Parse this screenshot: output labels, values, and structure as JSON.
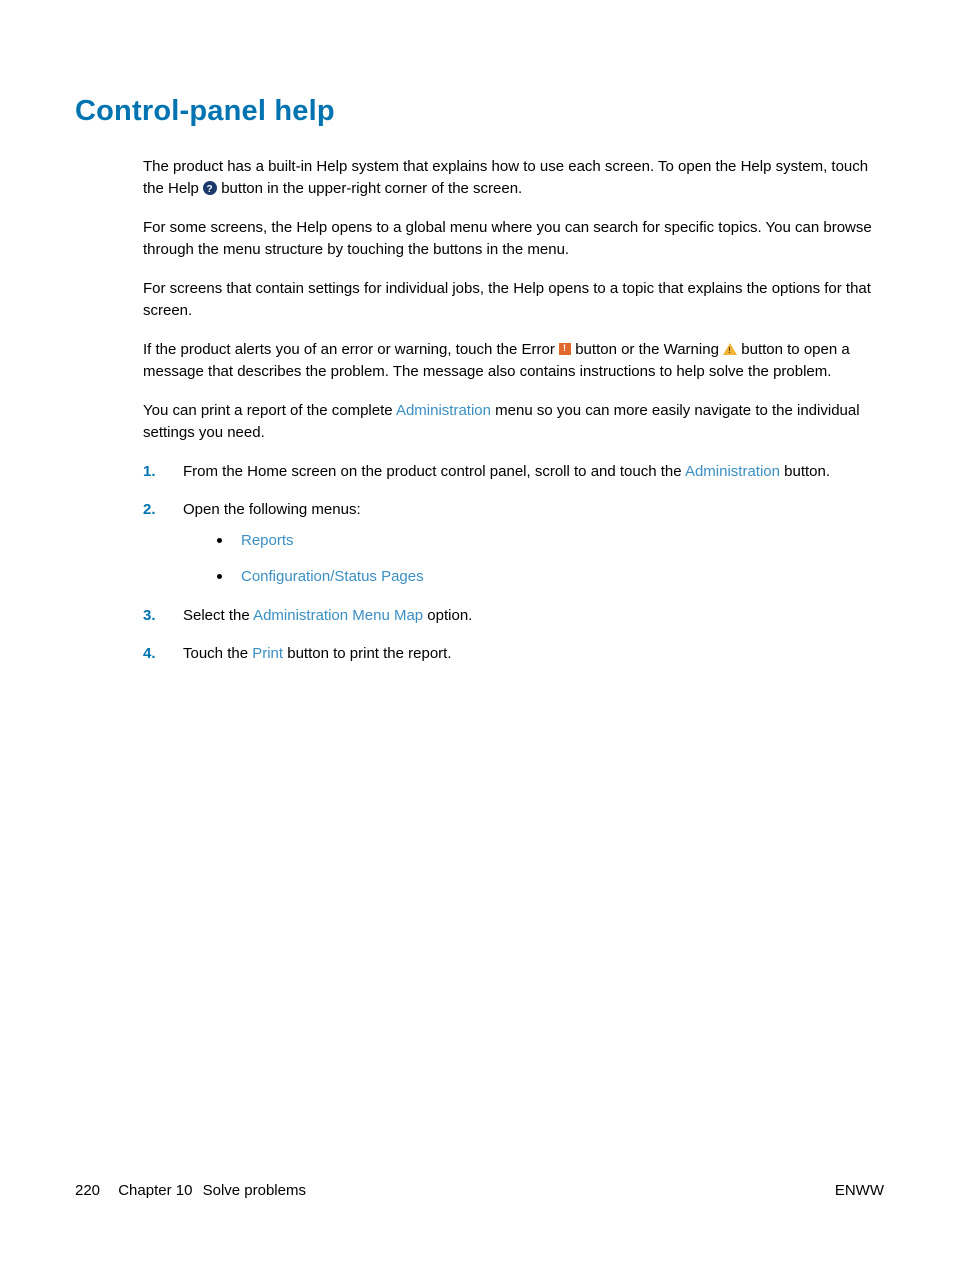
{
  "title": "Control-panel help",
  "para1_a": "The product has a built-in Help system that explains how to use each screen. To open the Help system, touch the Help ",
  "para1_b": " button in the upper-right corner of the screen.",
  "para2": "For some screens, the Help opens to a global menu where you can search for specific topics. You can browse through the menu structure by touching the buttons in the menu.",
  "para3": "For screens that contain settings for individual jobs, the Help opens to a topic that explains the options for that screen.",
  "para4_a": "If the product alerts you of an error or warning, touch the Error ",
  "para4_b": " button or the Warning ",
  "para4_c": " button to open a message that describes the problem. The message also contains instructions to help solve the problem.",
  "para5_a": "You can print a report of the complete ",
  "para5_admin": "Administration",
  "para5_b": " menu so you can more easily navigate to the individual settings you need.",
  "steps": {
    "s1_num": "1.",
    "s1_a": "From the Home screen on the product control panel, scroll to and touch the ",
    "s1_link": "Administration",
    "s1_b": " button.",
    "s2_num": "2.",
    "s2_text": "Open the following menus:",
    "s2_sub1": "Reports",
    "s2_sub2": "Configuration/Status Pages",
    "s3_num": "3.",
    "s3_a": "Select the ",
    "s3_link": "Administration Menu Map",
    "s3_b": " option.",
    "s4_num": "4.",
    "s4_a": "Touch the ",
    "s4_link": "Print",
    "s4_b": " button to print the report."
  },
  "footer": {
    "page": "220",
    "chapter": "Chapter 10",
    "section": "Solve problems",
    "right": "ENWW"
  },
  "icons": {
    "help": "help-icon",
    "error": "error-icon",
    "warning": "warning-icon"
  }
}
